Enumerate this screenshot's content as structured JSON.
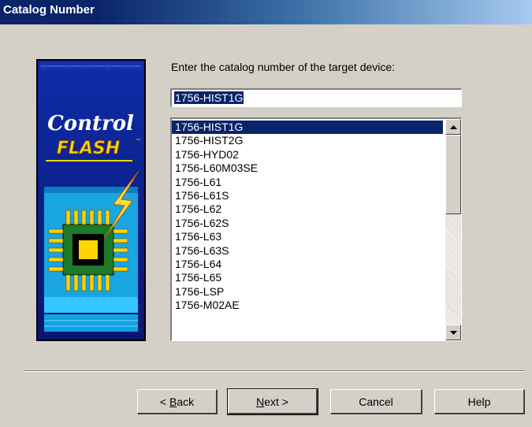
{
  "window": {
    "title": "Catalog Number"
  },
  "prompt_label": "Enter the catalog number of the target device:",
  "catalog_input": {
    "value": "1756-HIST1G"
  },
  "catalog_list": {
    "selected": "1756-HIST1G",
    "items": [
      "1756-HIST1G",
      "1756-HIST2G",
      "1756-HYD02",
      "1756-L60M03SE",
      "1756-L61",
      "1756-L61S",
      "1756-L62",
      "1756-L62S",
      "1756-L63",
      "1756-L63S",
      "1756-L64",
      "1756-L65",
      "1756-LSP",
      "1756-M02AE"
    ]
  },
  "logo": {
    "line1": "Control",
    "line2": "FLASH",
    "tm": "™"
  },
  "buttons": {
    "back": {
      "prefix": "< ",
      "mnemonic": "B",
      "rest": "ack"
    },
    "next": {
      "mnemonic": "N",
      "rest": "ext >"
    },
    "cancel": "Cancel",
    "help": "Help"
  },
  "colors": {
    "accent": "#0a246a",
    "logo_bg": "#0c1f8a",
    "logo_text_yellow": "#ffd400"
  }
}
